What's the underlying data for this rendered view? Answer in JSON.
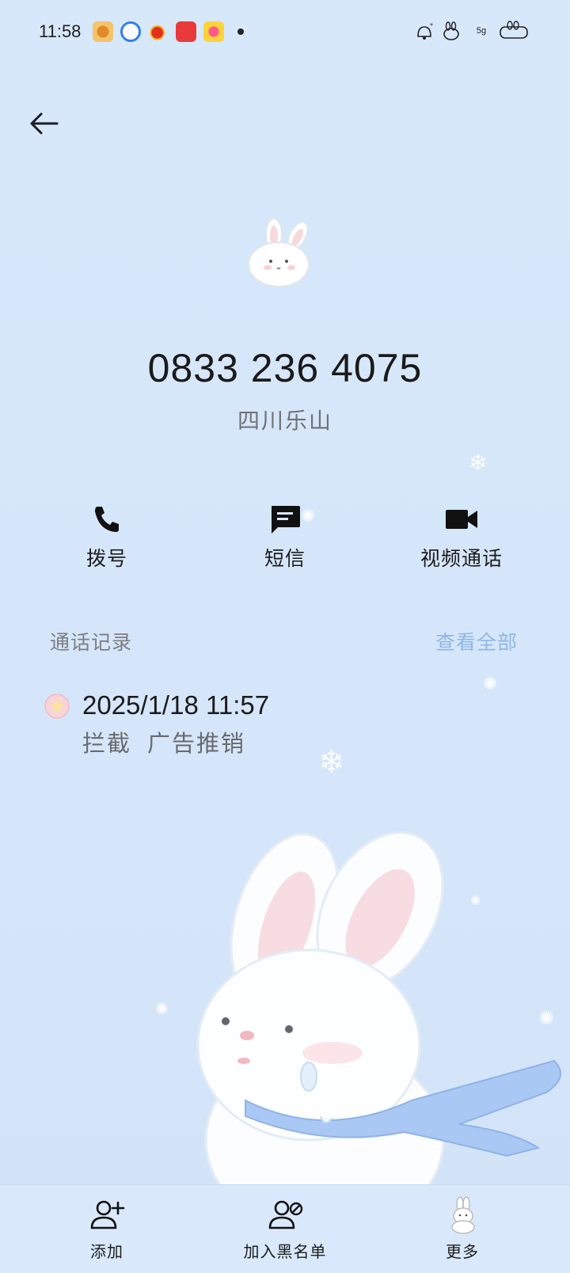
{
  "status_bar": {
    "time": "11:58",
    "network": "5g",
    "notification_icons": [
      "app-icon-orange",
      "app-icon-blue",
      "weibo-icon",
      "app-icon-red",
      "app-icon-flower"
    ]
  },
  "contact": {
    "phone_number": "0833 236 4075",
    "location": "四川乐山"
  },
  "actions": {
    "dial": "拨号",
    "sms": "短信",
    "video_call": "视频通话"
  },
  "call_log": {
    "title": "通话记录",
    "view_all": "查看全部",
    "items": [
      {
        "datetime": "2025/1/18 11:57",
        "status": "拦截",
        "tag": "广告推销"
      }
    ]
  },
  "bottom_bar": {
    "add": "添加",
    "blacklist": "加入黑名单",
    "more": "更多"
  },
  "colors": {
    "background": "#d8e8fb",
    "link": "#8db8e6",
    "text_primary": "#1a1a1a",
    "text_secondary": "#707275"
  }
}
